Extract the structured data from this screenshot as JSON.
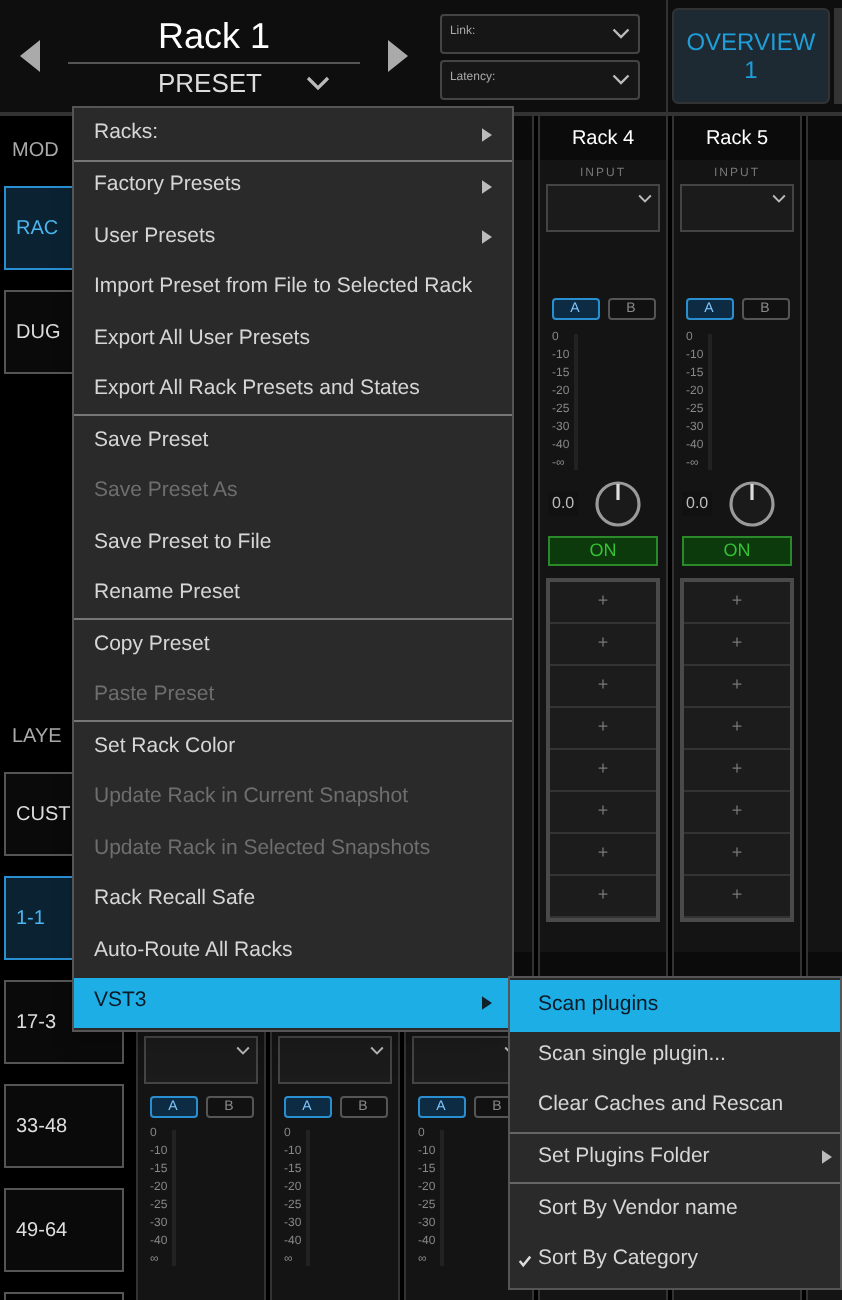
{
  "header": {
    "rack_title": "Rack 1",
    "preset_label": "PRESET",
    "link": {
      "label": "Link:"
    },
    "latency": {
      "label": "Latency:"
    },
    "overview_button": {
      "label": "OVERVIEW",
      "number": "1"
    }
  },
  "left_panel": {
    "mode_label": "MOD",
    "mode_buttons": [
      {
        "label": "RAC",
        "selected": true
      },
      {
        "label": "DUG",
        "selected": false
      }
    ],
    "layer_label": "LAYE",
    "layer_buttons": [
      {
        "label": "CUST",
        "selected": false
      },
      {
        "label": "1-1",
        "selected": true
      },
      {
        "label": "17-3",
        "selected": false
      },
      {
        "label": "33-48",
        "selected": false
      },
      {
        "label": "49-64",
        "selected": false
      }
    ]
  },
  "strips_top": [
    {
      "name": "Rack 4",
      "input_label": "INPUT",
      "a": {
        "label": "A",
        "selected": true
      },
      "b": {
        "label": "B",
        "selected": false
      },
      "scale": [
        "0",
        "-10",
        "-15",
        "-20",
        "-25",
        "-30",
        "-40",
        "-∞"
      ],
      "gain": "0.0",
      "on_button": {
        "label": "ON",
        "on": true
      },
      "slots": [
        "+",
        "+",
        "+",
        "+",
        "+",
        "+",
        "+",
        "+"
      ]
    },
    {
      "name": "Rack 5",
      "input_label": "INPUT",
      "a": {
        "label": "A",
        "selected": true
      },
      "b": {
        "label": "B",
        "selected": false
      },
      "scale": [
        "0",
        "-10",
        "-15",
        "-20",
        "-25",
        "-30",
        "-40",
        "-∞"
      ],
      "gain": "0.0",
      "on_button": {
        "label": "ON",
        "on": true
      },
      "slots": [
        "+",
        "+",
        "+",
        "+",
        "+",
        "+",
        "+",
        "+"
      ]
    }
  ],
  "strips_bottom": [
    {
      "a": {
        "label": "A",
        "selected": true
      },
      "b": {
        "label": "B",
        "selected": false
      },
      "scale": [
        "0",
        "-10",
        "-15",
        "-20",
        "-25",
        "-30",
        "-40",
        "∞"
      ]
    },
    {
      "a": {
        "label": "A",
        "selected": true
      },
      "b": {
        "label": "B",
        "selected": false
      },
      "scale": [
        "0",
        "-10",
        "-15",
        "-20",
        "-25",
        "-30",
        "-40",
        "∞"
      ]
    },
    {
      "a": {
        "label": "A",
        "selected": true
      },
      "b": {
        "label": "B",
        "selected": false
      },
      "scale": [
        "0",
        "-10",
        "-15",
        "-20",
        "-25",
        "-30",
        "-40",
        "∞"
      ]
    }
  ],
  "menu": {
    "items": [
      {
        "label": "Racks:",
        "submenu": true,
        "disabled": false,
        "selected": false,
        "separator_after": true
      },
      {
        "label": "Factory Presets",
        "submenu": true,
        "disabled": false,
        "selected": false,
        "separator_after": false
      },
      {
        "label": "User Presets",
        "submenu": true,
        "disabled": false,
        "selected": false,
        "separator_after": false
      },
      {
        "label": "Import Preset from File to Selected Rack",
        "submenu": false,
        "disabled": false,
        "selected": false,
        "separator_after": false
      },
      {
        "label": "Export All User Presets",
        "submenu": false,
        "disabled": false,
        "selected": false,
        "separator_after": false
      },
      {
        "label": "Export All Rack Presets and States",
        "submenu": false,
        "disabled": false,
        "selected": false,
        "separator_after": true
      },
      {
        "label": "Save Preset",
        "submenu": false,
        "disabled": false,
        "selected": false,
        "separator_after": false
      },
      {
        "label": "Save Preset As",
        "submenu": false,
        "disabled": true,
        "selected": false,
        "separator_after": false
      },
      {
        "label": "Save Preset to File",
        "submenu": false,
        "disabled": false,
        "selected": false,
        "separator_after": false
      },
      {
        "label": "Rename Preset",
        "submenu": false,
        "disabled": false,
        "selected": false,
        "separator_after": true
      },
      {
        "label": "Copy Preset",
        "submenu": false,
        "disabled": false,
        "selected": false,
        "separator_after": false
      },
      {
        "label": "Paste Preset",
        "submenu": false,
        "disabled": true,
        "selected": false,
        "separator_after": true
      },
      {
        "label": "Set Rack Color",
        "submenu": false,
        "disabled": false,
        "selected": false,
        "separator_after": false
      },
      {
        "label": "Update Rack in Current Snapshot",
        "submenu": false,
        "disabled": true,
        "selected": false,
        "separator_after": false
      },
      {
        "label": "Update Rack in Selected Snapshots",
        "submenu": false,
        "disabled": true,
        "selected": false,
        "separator_after": false
      },
      {
        "label": "Rack Recall Safe",
        "submenu": false,
        "disabled": false,
        "selected": false,
        "separator_after": false
      },
      {
        "label": "Auto-Route All Racks",
        "submenu": false,
        "disabled": false,
        "selected": false,
        "separator_after": false
      },
      {
        "label": "VST3",
        "submenu": true,
        "disabled": false,
        "selected": true,
        "separator_after": false
      }
    ]
  },
  "submenu": {
    "items": [
      {
        "label": "Scan plugins",
        "submenu": false,
        "selected": true,
        "checked": false,
        "separator_after": false
      },
      {
        "label": "Scan single plugin...",
        "submenu": false,
        "selected": false,
        "checked": false,
        "separator_after": false
      },
      {
        "label": "Clear Caches and Rescan",
        "submenu": false,
        "selected": false,
        "checked": false,
        "separator_after": true
      },
      {
        "label": "Set Plugins Folder",
        "submenu": true,
        "selected": false,
        "checked": false,
        "separator_after": true
      },
      {
        "label": "Sort By Vendor name",
        "submenu": false,
        "selected": false,
        "checked": false,
        "separator_after": false
      },
      {
        "label": "Sort By Category",
        "submenu": false,
        "selected": false,
        "checked": true,
        "separator_after": false
      }
    ]
  }
}
